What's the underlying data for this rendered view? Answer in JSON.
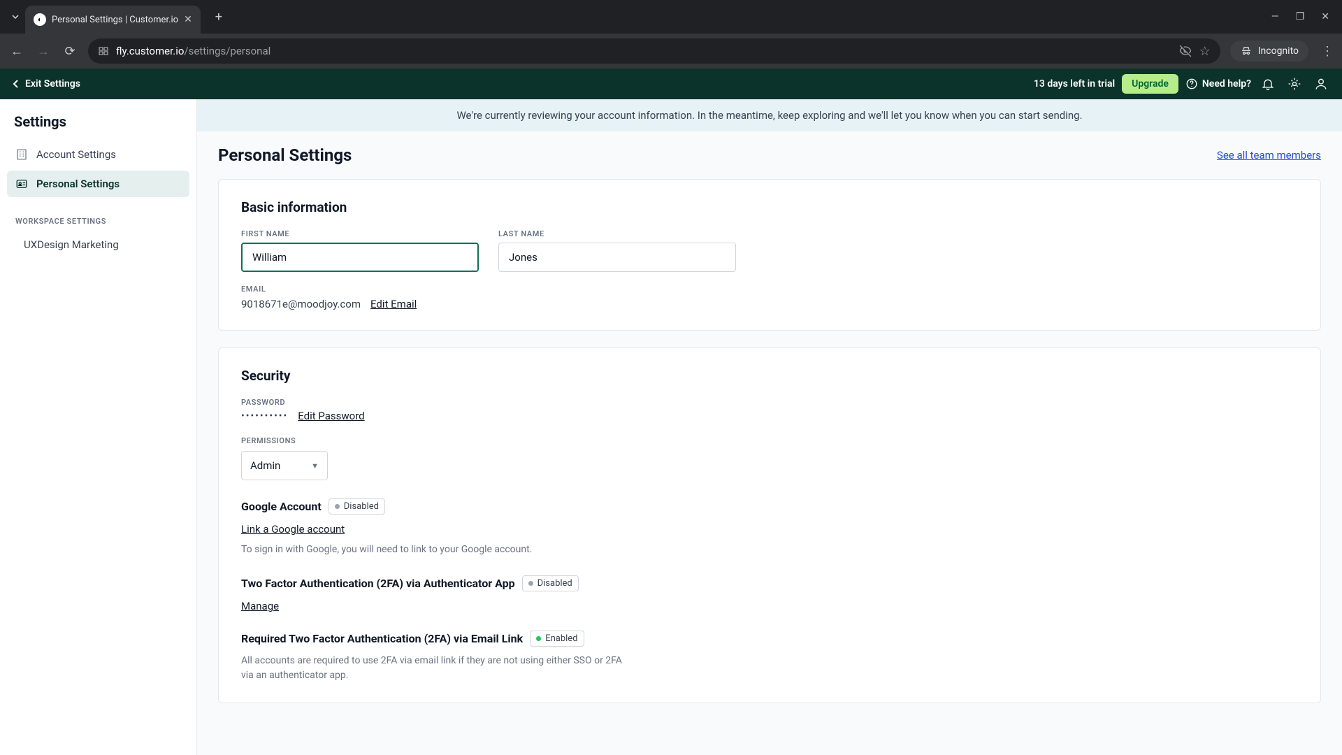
{
  "browser": {
    "tab_title": "Personal Settings | Customer.io",
    "url_domain": "fly.customer.io",
    "url_path": "/settings/personal",
    "incognito_label": "Incognito"
  },
  "header": {
    "exit_label": "Exit Settings",
    "trial_text": "13 days left in trial",
    "upgrade_label": "Upgrade",
    "help_label": "Need help?"
  },
  "sidebar": {
    "title": "Settings",
    "items": [
      {
        "label": "Account Settings"
      },
      {
        "label": "Personal Settings"
      }
    ],
    "workspace_section_label": "WORKSPACE SETTINGS",
    "workspace_name": "UXDesign Marketing"
  },
  "banner": {
    "text": "We're currently reviewing your account information. In the meantime, keep exploring and we'll let you know when you can start sending."
  },
  "page": {
    "title": "Personal Settings",
    "team_link": "See all team members"
  },
  "basic": {
    "heading": "Basic information",
    "first_name_label": "FIRST NAME",
    "first_name_value": "William",
    "last_name_label": "LAST NAME",
    "last_name_value": "Jones",
    "email_label": "EMAIL",
    "email_value": "9018671e@moodjoy.com",
    "edit_email_label": "Edit Email"
  },
  "security": {
    "heading": "Security",
    "password_label": "PASSWORD",
    "password_mask": "••••••••••",
    "edit_password_label": "Edit Password",
    "permissions_label": "PERMISSIONS",
    "permissions_value": "Admin",
    "google": {
      "title": "Google Account",
      "status": "Disabled",
      "link_label": "Link a Google account",
      "desc": "To sign in with Google, you will need to link to your Google account."
    },
    "tfa_app": {
      "title": "Two Factor Authentication (2FA) via Authenticator App",
      "status": "Disabled",
      "manage_label": "Manage"
    },
    "tfa_email": {
      "title": "Required Two Factor Authentication (2FA) via Email Link",
      "status": "Enabled",
      "desc": "All accounts are required to use 2FA via email link if they are not using either SSO or 2FA via an authenticator app."
    }
  }
}
